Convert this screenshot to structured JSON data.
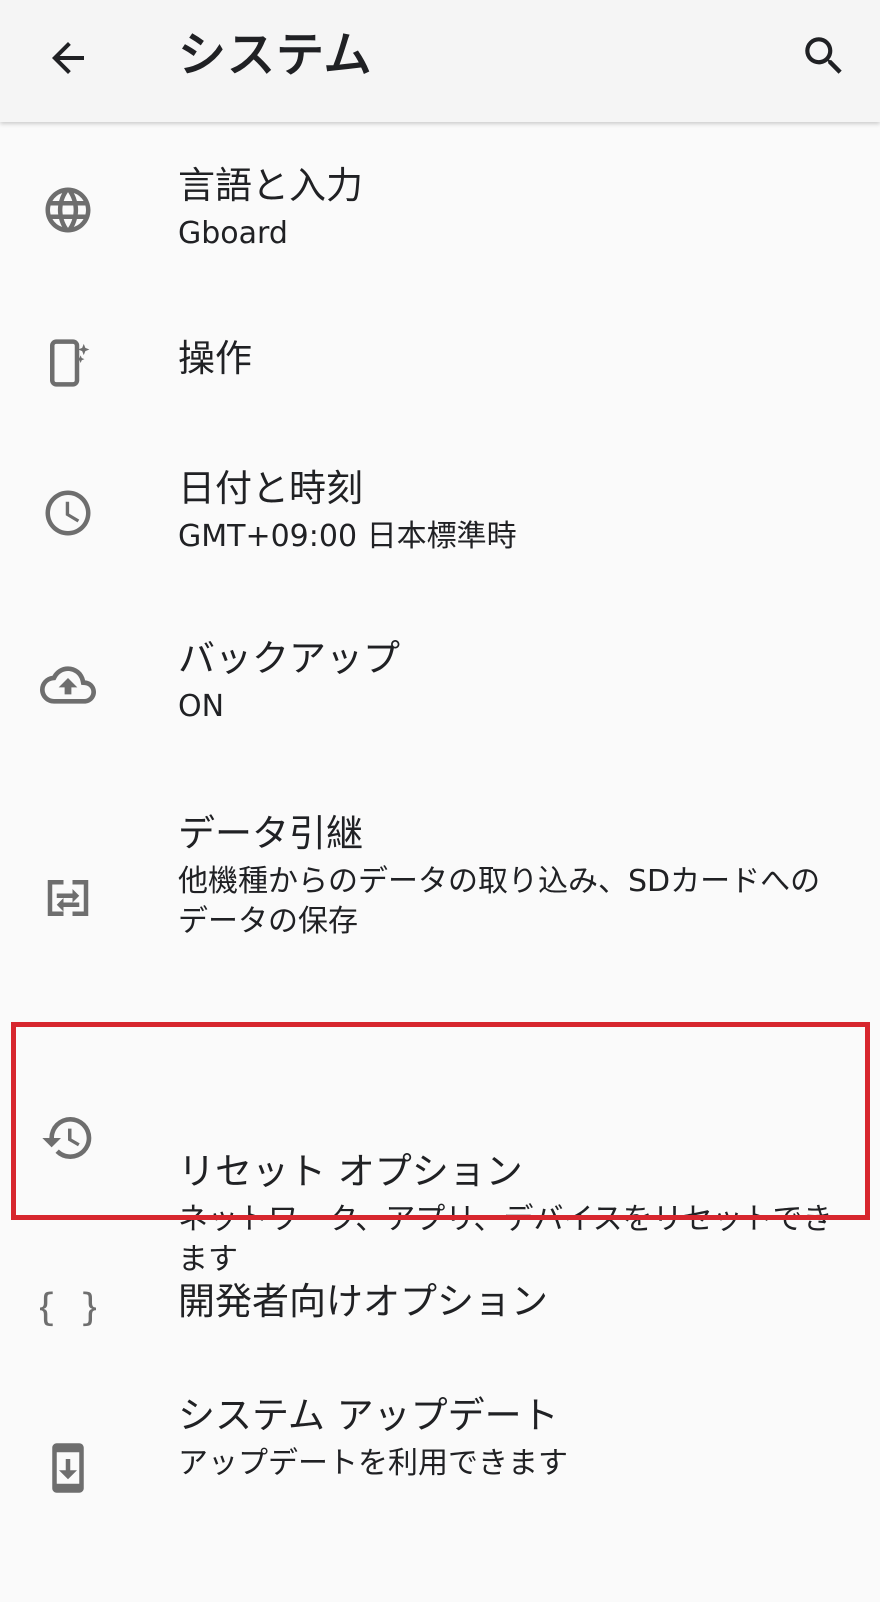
{
  "app_bar": {
    "title": "システム",
    "back_icon": "arrow-back-icon",
    "search_icon": "search-icon"
  },
  "items": [
    {
      "icon": "globe-icon",
      "label": "言語と入力",
      "summary": "Gboard"
    },
    {
      "icon": "phone-gesture-icon",
      "label": "操作",
      "summary": ""
    },
    {
      "icon": "clock-icon",
      "label": "日付と時刻",
      "summary": "GMT+09:00 日本標準時"
    },
    {
      "icon": "cloud-upload-icon",
      "label": "バックアップ",
      "summary": "ON"
    },
    {
      "icon": "data-transfer-icon",
      "label": "データ引継",
      "summary": "他機種からのデータの取り込み、SDカードへのデータの保存"
    },
    {
      "icon": "history-reset-icon",
      "label": "リセット オプション",
      "summary": "ネットワーク、アプリ、デバイスをリセットできます"
    },
    {
      "icon": "braces-icon",
      "label": "開発者向けオプション",
      "summary": ""
    },
    {
      "icon": "system-update-icon",
      "label": "システム アップデート",
      "summary": "アップデートを利用できます"
    }
  ],
  "colors": {
    "highlight": "#d7262e",
    "icon": "#6e6e6e",
    "background": "#fafafa"
  }
}
